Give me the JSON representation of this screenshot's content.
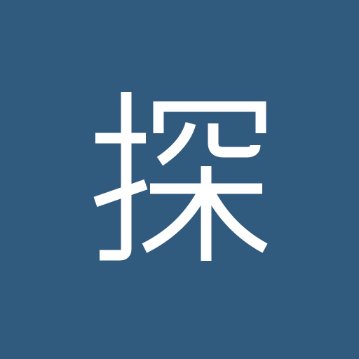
{
  "avatar": {
    "character": "探",
    "background_color": "#305a7e",
    "glyph_color": "#ffffff"
  }
}
